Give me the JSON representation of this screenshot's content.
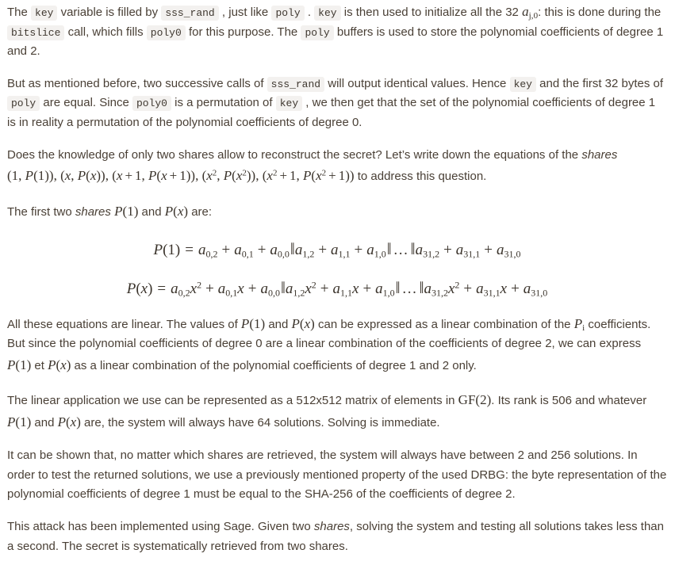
{
  "document": {
    "paragraphs": [
      {
        "id": "p1",
        "segments": [
          {
            "type": "text",
            "value": "The "
          },
          {
            "type": "code",
            "value": "key"
          },
          {
            "type": "text",
            "value": " variable is filled by "
          },
          {
            "type": "code",
            "value": "sss_rand"
          },
          {
            "type": "text",
            "value": " , just like "
          },
          {
            "type": "code",
            "value": "poly"
          },
          {
            "type": "text",
            "value": " . "
          },
          {
            "type": "code",
            "value": "key"
          },
          {
            "type": "text",
            "value": " is then used to initialize all the 32 "
          },
          {
            "type": "math",
            "value": "a_{j,0}"
          },
          {
            "type": "text",
            "value": ": this is done during the "
          },
          {
            "type": "code",
            "value": "bitslice"
          },
          {
            "type": "text",
            "value": " call, which fills "
          },
          {
            "type": "code",
            "value": "poly0"
          },
          {
            "type": "text",
            "value": " for this purpose. The "
          },
          {
            "type": "code",
            "value": "poly"
          },
          {
            "type": "text",
            "value": " buffers is used to store the polynomial coefficients of degree 1 and 2."
          }
        ]
      },
      {
        "id": "p2",
        "segments": [
          {
            "type": "text",
            "value": "But as mentioned before, two successive calls of "
          },
          {
            "type": "code",
            "value": "sss_rand"
          },
          {
            "type": "text",
            "value": " will output identical values. Hence "
          },
          {
            "type": "code",
            "value": "key"
          },
          {
            "type": "text",
            "value": " and the first 32 bytes of "
          },
          {
            "type": "code",
            "value": "poly"
          },
          {
            "type": "text",
            "value": " are equal. Since "
          },
          {
            "type": "code",
            "value": "poly0"
          },
          {
            "type": "text",
            "value": " is a permutation of "
          },
          {
            "type": "code",
            "value": "key"
          },
          {
            "type": "text",
            "value": " , we then get that the set of the polynomial coefficients of degree 1 is in reality a permutation of the polynomial coefficients of degree 0."
          }
        ]
      },
      {
        "id": "p3",
        "segments": [
          {
            "type": "text",
            "value": "Does the knowledge of only two shares allow to reconstruct the secret? Let's write down the equations of the "
          },
          {
            "type": "italic",
            "value": "shares"
          },
          {
            "type": "math",
            "value": "(1, P(1)), (x, P(x)), (x + 1, P(x + 1)), (x^2, P(x^2)), (x^2 + 1, P(x^2 + 1))"
          },
          {
            "type": "text",
            "value": " to address this question."
          }
        ]
      },
      {
        "id": "p4",
        "segments": [
          {
            "type": "text",
            "value": "The first two "
          },
          {
            "type": "italic",
            "value": "shares"
          },
          {
            "type": "math",
            "value": "P(1)"
          },
          {
            "type": "text",
            "value": " and "
          },
          {
            "type": "math",
            "value": "P(x)"
          },
          {
            "type": "text",
            "value": " are:"
          }
        ]
      },
      {
        "id": "p5",
        "segments": [
          {
            "type": "text",
            "value": "All these equations are linear. The values of "
          },
          {
            "type": "math",
            "value": "P(1)"
          },
          {
            "type": "text",
            "value": " and "
          },
          {
            "type": "math",
            "value": "P(x)"
          },
          {
            "type": "text",
            "value": " can be expressed as a linear combination of the "
          },
          {
            "type": "math",
            "value": "P_i"
          },
          {
            "type": "text",
            "value": " coefficients. But since the polynomial coefficients of degree 0 are a linear combination of the coefficients of degree 2, we can express "
          },
          {
            "type": "math",
            "value": "P(1)"
          },
          {
            "type": "text",
            "value": " et "
          },
          {
            "type": "math",
            "value": "P(x)"
          },
          {
            "type": "text",
            "value": " as a linear combination of the polynomial coefficients of degree 1 and 2 only."
          }
        ]
      },
      {
        "id": "p6",
        "segments": [
          {
            "type": "text",
            "value": "The linear application we use can be represented as a 512x512 matrix of elements in "
          },
          {
            "type": "math",
            "value": "GF(2)"
          },
          {
            "type": "text",
            "value": ". Its rank is 506 and whatever "
          },
          {
            "type": "math",
            "value": "P(1)"
          },
          {
            "type": "text",
            "value": " and "
          },
          {
            "type": "math",
            "value": "P(x)"
          },
          {
            "type": "text",
            "value": " are, the system will always have 64 solutions. Solving is immediate."
          }
        ]
      },
      {
        "id": "p7",
        "segments": [
          {
            "type": "text",
            "value": "It can be shown that, no matter which shares are retrieved, the system will always have between 2 and 256 solutions. In order to test the returned solutions, we use a previously mentioned property of the used DRBG: the byte representation of the polynomial coefficients of degree 1 must be equal to the SHA-256 of the coefficients of degree 2."
          }
        ]
      },
      {
        "id": "p8",
        "segments": [
          {
            "type": "text",
            "value": "This attack has been implemented using Sage. Given two "
          },
          {
            "type": "italic",
            "value": "shares"
          },
          {
            "type": "text",
            "value": ", solving the system and testing all solutions takes less than a second. The secret is systematically retrieved from two shares."
          }
        ]
      }
    ],
    "equations": [
      {
        "id": "eq1",
        "latex": "P(1) = a_{0,2} + a_{0,1} + a_{0,0} || a_{1,2} + a_{1,1} + a_{1,0} || ... || a_{31,2} + a_{31,1} + a_{31,0}"
      },
      {
        "id": "eq2",
        "latex": "P(x) = a_{0,2}x^2 + a_{0,1}x + a_{0,0} || a_{1,2}x^2 + a_{1,1}x + a_{1,0} || ... || a_{31,2}x^2 + a_{31,1}x + a_{31,0}"
      }
    ],
    "text": {
      "p1_a": "The ",
      "p1_b": " variable is filled by ",
      "p1_c": " , just like ",
      "p1_d": " . ",
      "p1_e": " is then used to initialize all the 32 ",
      "p1_f": ": this is done during the ",
      "p1_g": " call, which fills ",
      "p1_h": " for this purpose. The ",
      "p1_i": " buffers is used to store the polynomial coefficients of degree 1 and 2.",
      "p2_a": "But as mentioned before, two successive calls of ",
      "p2_b": " will output identical values. Hence ",
      "p2_c": " and the first 32 bytes of ",
      "p2_d": " are equal. Since ",
      "p2_e": " is a permutation of ",
      "p2_f": " , we then get that the set of the polynomial coefficients of degree 1 is in reality a permutation of the polynomial coefficients of degree 0.",
      "p3_a": "Does the knowledge of only two shares allow to reconstruct the secret? Let’s write down the equations of the ",
      "p3_shares": "shares",
      "p3_b": " to address this question.",
      "p4_a": "The first two ",
      "p4_shares": "shares",
      "p4_and": " and ",
      "p4_b": " are:",
      "p5_a": "All these equations are linear. The values of ",
      "p5_and": " and ",
      "p5_b": " can be expressed as a linear combination of the ",
      "p5_c": " coefficients. But since the polynomial coefficients of degree 0 are a linear combination of the coefficients of degree 2, we can express ",
      "p5_et": " et ",
      "p5_d": " as a linear combination of the polynomial coefficients of degree 1 and 2 only.",
      "p6_a": "The linear application we use can be represented as a 512x512 matrix of elements in ",
      "p6_b": ". Its rank is 506 and whatever ",
      "p6_and": " and ",
      "p6_c": " are, the system will always have 64 solutions. Solving is immediate.",
      "p7_a": "It can be shown that, no matter which shares are retrieved, the system will always have between 2 and 256 solutions. In order to test the returned solutions, we use a previously mentioned property of the used DRBG: the byte representation of the polynomial coefficients of degree 1 must be equal to the SHA-256 of the coefficients of degree 2.",
      "p8_a": "This attack has been implemented using Sage. Given two ",
      "p8_shares": "shares",
      "p8_b": ", solving the system and testing all solutions takes less than a second. The secret is systematically retrieved from two shares."
    },
    "code_tokens": {
      "key": "key",
      "sss_rand": "sss_rand",
      "poly": "poly",
      "poly0": "poly0",
      "bitslice": "bitslice"
    },
    "math_tokens": {
      "a_j0_base": "a",
      "a_j0_sub": "j,0",
      "P": "P",
      "one": "1",
      "x": "x",
      "two": "2",
      "i": "i",
      "GF": "GF",
      "a": "a",
      "dots": "…",
      "eq": "=",
      "plus": "+",
      "bars": "‖",
      "s_02": "0,2",
      "s_01": "0,1",
      "s_00": "0,0",
      "s_12": "1,2",
      "s_11": "1,1",
      "s_10": "1,0",
      "s_312": "31,2",
      "s_311": "31,1",
      "s_310": "31,0"
    },
    "colors": {
      "background": "#ffffff",
      "body_text": "#4a4036",
      "math_text": "#3b342c",
      "code_background": "#f3f1ef",
      "code_text": "#3f3830"
    }
  }
}
